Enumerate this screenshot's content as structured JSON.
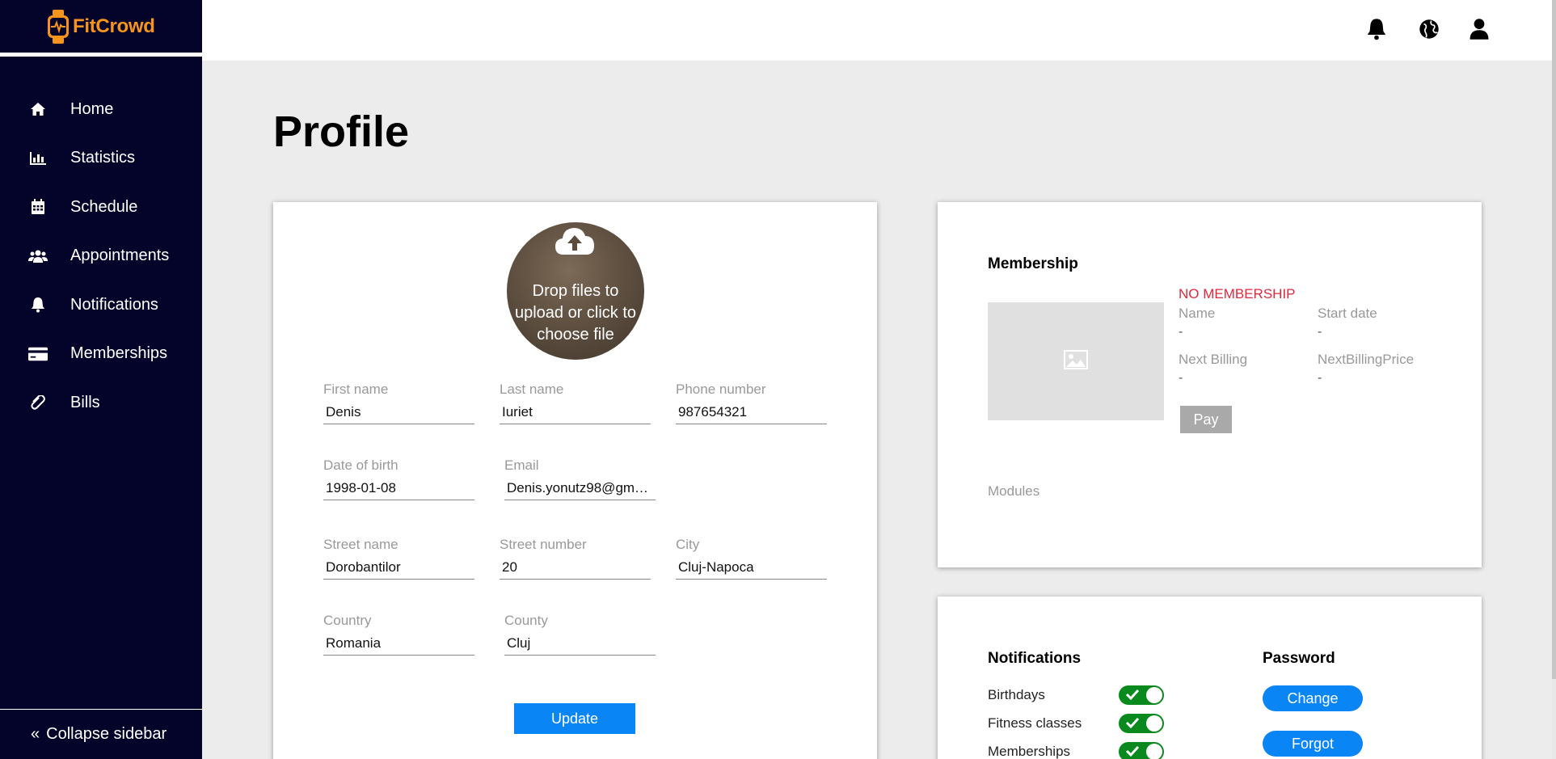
{
  "app": {
    "name": "FitCrowd",
    "brand_color": "#f7941d",
    "sidebar_bg": "#04042a",
    "accent": "#0a85f5"
  },
  "sidebar": {
    "items": [
      {
        "label": "Home",
        "icon": "home-icon"
      },
      {
        "label": "Statistics",
        "icon": "bar-chart-icon"
      },
      {
        "label": "Schedule",
        "icon": "calendar-icon"
      },
      {
        "label": "Appointments",
        "icon": "users-icon"
      },
      {
        "label": "Notifications",
        "icon": "bell-icon"
      },
      {
        "label": "Memberships",
        "icon": "credit-card-icon"
      },
      {
        "label": "Bills",
        "icon": "paperclip-icon"
      }
    ],
    "collapse_label": "Collapse sidebar"
  },
  "topbar": {
    "icons": [
      "bell-icon",
      "globe-icon",
      "user-icon"
    ]
  },
  "page": {
    "title": "Profile"
  },
  "profile": {
    "upload_text": "Drop files to upload or click to choose file",
    "fields": {
      "first_name": {
        "label": "First name",
        "value": "Denis"
      },
      "last_name": {
        "label": "Last name",
        "value": "Iuriet"
      },
      "phone": {
        "label": "Phone number",
        "value": "987654321"
      },
      "dob": {
        "label": "Date of birth",
        "value": "1998-01-08"
      },
      "email": {
        "label": "Email",
        "value": "Denis.yonutz98@gm…"
      },
      "street_name": {
        "label": "Street name",
        "value": "Dorobantilor"
      },
      "street_number": {
        "label": "Street number",
        "value": "20"
      },
      "city": {
        "label": "City",
        "value": "Cluj-Napoca"
      },
      "country": {
        "label": "Country",
        "value": "Romania"
      },
      "county": {
        "label": "County",
        "value": "Cluj"
      }
    },
    "update_label": "Update"
  },
  "membership": {
    "title": "Membership",
    "status": "NO MEMBERSHIP",
    "name_label": "Name",
    "name_value": "-",
    "start_label": "Start date",
    "start_value": "-",
    "billing_label": "Next Billing",
    "billing_value": "-",
    "price_label": "NextBillingPrice",
    "price_value": "-",
    "pay_label": "Pay",
    "modules_label": "Modules"
  },
  "settings": {
    "notifications_title": "Notifications",
    "notifications": [
      {
        "label": "Birthdays",
        "enabled": true
      },
      {
        "label": "Fitness classes",
        "enabled": true
      },
      {
        "label": "Memberships",
        "enabled": true
      }
    ],
    "password_title": "Password",
    "change_label": "Change",
    "forgot_label": "Forgot"
  }
}
